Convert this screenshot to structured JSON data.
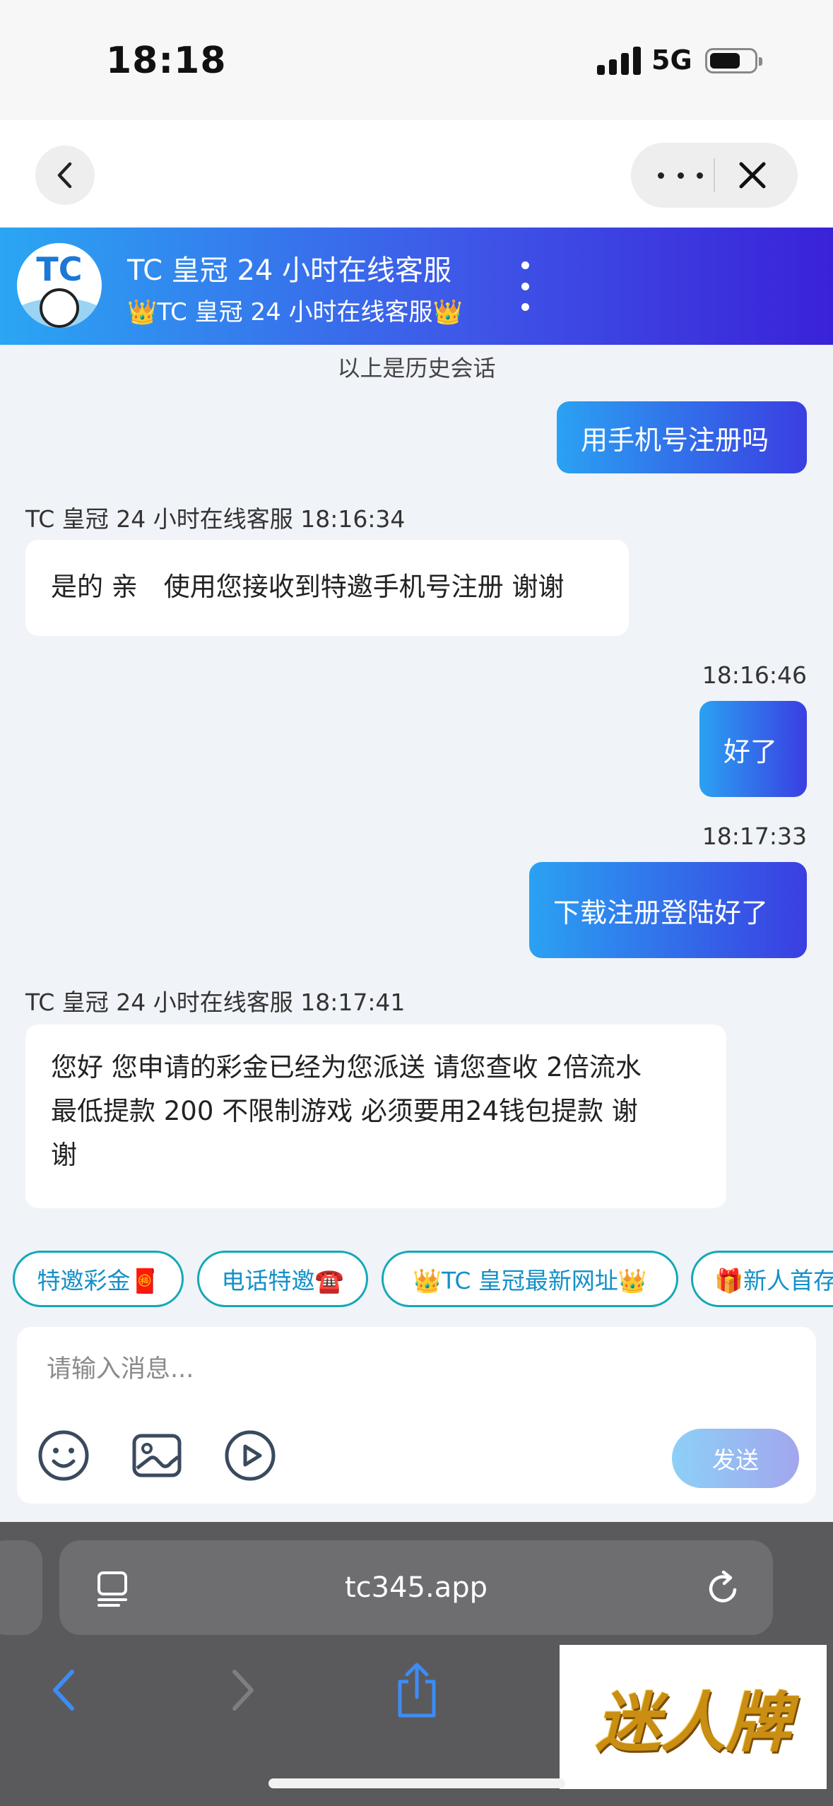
{
  "status_bar": {
    "time": "18:18",
    "network": "5G",
    "battery_level": 0.7
  },
  "chat_header": {
    "logo_text": "TC",
    "title": "TC 皇冠 24 小时在线客服",
    "subtitle": "👑TC 皇冠 24 小时在线客服👑"
  },
  "history_note": "以上是历史会话",
  "messages": [
    {
      "direction": "out",
      "text": "用手机号注册吗"
    },
    {
      "direction": "in",
      "sender": "TC 皇冠 24 小时在线客服 18:16:34",
      "text": "是的 亲　使用您接收到特邀手机号注册 谢谢"
    },
    {
      "direction": "out",
      "time": "18:16:46",
      "text": "好了"
    },
    {
      "direction": "out",
      "time": "18:17:33",
      "text": "下载注册登陆好了"
    },
    {
      "direction": "in",
      "sender": "TC 皇冠 24 小时在线客服 18:17:41",
      "lines": [
        "您好 您申请的彩金已经为您派送 请您查收 2倍流水",
        "最低提款 200 不限制游戏  必须要用24钱包提款 谢",
        "谢"
      ]
    }
  ],
  "quick_replies": [
    "特邀彩金🧧",
    "电话特邀☎️",
    "👑TC 皇冠最新网址👑",
    "🎁新人首存"
  ],
  "composer": {
    "placeholder": "请输入消息...",
    "send_label": "发送"
  },
  "browser": {
    "url": "tc345.app"
  },
  "watermark": "迷人牌"
}
